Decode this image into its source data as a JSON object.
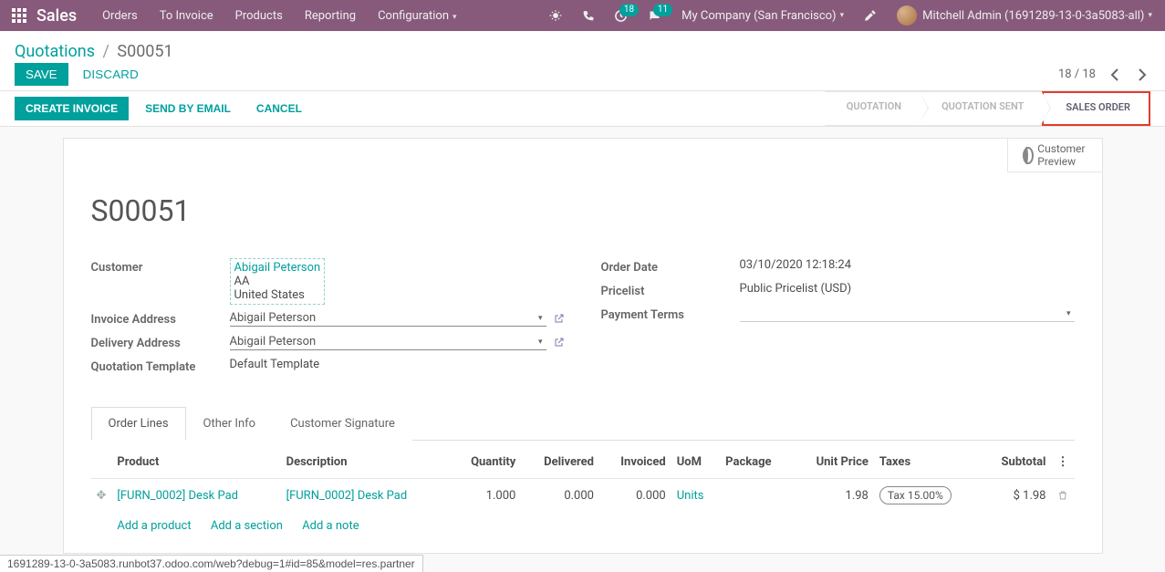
{
  "topnav": {
    "brand": "Sales",
    "menu": [
      "Orders",
      "To Invoice",
      "Products",
      "Reporting",
      "Configuration"
    ],
    "activity_badge": "18",
    "messages_badge": "11",
    "company": "My Company (San Francisco)",
    "user": "Mitchell Admin (1691289-13-0-3a5083-all)"
  },
  "breadcrumb": {
    "root": "Quotations",
    "current": "S00051"
  },
  "cp": {
    "save": "SAVE",
    "discard": "DISCARD",
    "pager": "18 / 18"
  },
  "statusbar": {
    "create_invoice": "CREATE INVOICE",
    "send_email": "SEND BY EMAIL",
    "cancel": "CANCEL",
    "stages": {
      "quotation": "QUOTATION",
      "quotation_sent": "QUOTATION SENT",
      "sales_order": "SALES ORDER"
    }
  },
  "buttonbox": {
    "line1": "Customer",
    "line2": "Preview"
  },
  "form": {
    "title": "S00051",
    "labels": {
      "customer": "Customer",
      "invoice_address": "Invoice Address",
      "delivery_address": "Delivery Address",
      "quotation_template": "Quotation Template",
      "order_date": "Order Date",
      "pricelist": "Pricelist",
      "payment_terms": "Payment Terms"
    },
    "customer": {
      "name": "Abigail Peterson",
      "line2": "AA",
      "country": "United States"
    },
    "invoice_address": "Abigail Peterson",
    "delivery_address": "Abigail Peterson",
    "quotation_template": "Default Template",
    "order_date": "03/10/2020 12:18:24",
    "pricelist": "Public Pricelist (USD)"
  },
  "tabs": {
    "order_lines": "Order Lines",
    "other_info": "Other Info",
    "customer_signature": "Customer Signature"
  },
  "columns": {
    "product": "Product",
    "description": "Description",
    "quantity": "Quantity",
    "delivered": "Delivered",
    "invoiced": "Invoiced",
    "uom": "UoM",
    "package": "Package",
    "unit_price": "Unit Price",
    "taxes": "Taxes",
    "subtotal": "Subtotal"
  },
  "lines": [
    {
      "product": "[FURN_0002] Desk Pad",
      "description": "[FURN_0002] Desk Pad",
      "quantity": "1.000",
      "delivered": "0.000",
      "invoiced": "0.000",
      "uom": "Units",
      "package": "",
      "unit_price": "1.98",
      "taxes": "Tax 15.00%",
      "subtotal": "$ 1.98"
    }
  ],
  "add": {
    "product": "Add a product",
    "section": "Add a section",
    "note": "Add a note"
  },
  "footer_url": "1691289-13-0-3a5083.runbot37.odoo.com/web?debug=1#id=85&model=res.partner"
}
